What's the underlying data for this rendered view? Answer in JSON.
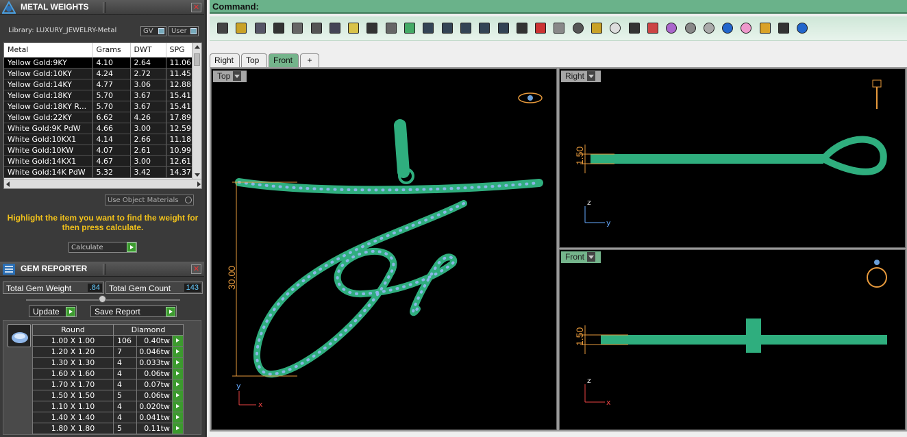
{
  "metal_weights": {
    "title": "METAL WEIGHTS",
    "library": "Library: LUXURY_JEWELRY-Metal",
    "toggle_gv": "GV",
    "toggle_user": "User",
    "columns": [
      "Metal",
      "Grams",
      "DWT",
      "SPG"
    ],
    "rows": [
      [
        "Yellow Gold:9KY",
        "4.10",
        "2.64",
        "11.06"
      ],
      [
        "Yellow Gold:10KY",
        "4.24",
        "2.72",
        "11.45"
      ],
      [
        "Yellow Gold:14KY",
        "4.77",
        "3.06",
        "12.88"
      ],
      [
        "Yellow Gold:18KY",
        "5.70",
        "3.67",
        "15.41"
      ],
      [
        "Yellow Gold:18KY R...",
        "5.70",
        "3.67",
        "15.41"
      ],
      [
        "Yellow Gold:22KY",
        "6.62",
        "4.26",
        "17.89"
      ],
      [
        "White Gold:9K PdW",
        "4.66",
        "3.00",
        "12.59"
      ],
      [
        "White Gold:10KX1",
        "4.14",
        "2.66",
        "11.18"
      ],
      [
        "White Gold:10KW",
        "4.07",
        "2.61",
        "10.99"
      ],
      [
        "White Gold:14KX1",
        "4.67",
        "3.00",
        "12.61"
      ],
      [
        "White Gold:14K PdW",
        "5.32",
        "3.42",
        "14.37"
      ]
    ],
    "use_object_materials": "Use Object Materials",
    "hint": "Highlight the item you want to find the weight for then press calculate.",
    "calculate": "Calculate"
  },
  "gem_reporter": {
    "title": "GEM REPORTER",
    "total_weight_label": "Total Gem Weight",
    "total_weight": ".84",
    "total_count_label": "Total Gem Count",
    "total_count": "143",
    "update": "Update",
    "save_report": "Save Report",
    "header_shape": "Round",
    "header_material": "Diamond",
    "rows": [
      [
        "1.00 X 1.00",
        "106",
        "0.40tw"
      ],
      [
        "1.20 X 1.20",
        "7",
        "0.046tw"
      ],
      [
        "1.30 X 1.30",
        "4",
        "0.033tw"
      ],
      [
        "1.60 X 1.60",
        "4",
        "0.06tw"
      ],
      [
        "1.70 X 1.70",
        "4",
        "0.07tw"
      ],
      [
        "1.50 X 1.50",
        "5",
        "0.06tw"
      ],
      [
        "1.10 X 1.10",
        "4",
        "0.020tw"
      ],
      [
        "1.40 X 1.40",
        "4",
        "0.041tw"
      ],
      [
        "1.80 X 1.80",
        "5",
        "0.11tw"
      ]
    ]
  },
  "command": {
    "label": "Command:"
  },
  "toolbar_icons": [
    "new-icon",
    "open-icon",
    "save-icon",
    "print-icon",
    "import-icon",
    "cut-icon",
    "copy-icon",
    "paste-icon",
    "undo-icon",
    "pan-icon",
    "move-icon",
    "zoom-icon",
    "zoom-window-icon",
    "zoom-extents-icon",
    "zoom-selected-icon",
    "rotate-view-icon",
    "viewport-layout-icon",
    "car-icon",
    "plane-icon",
    "gumball-icon",
    "osnap-icon",
    "light-icon",
    "lock-icon",
    "layers-icon",
    "color-wheel-icon",
    "sphere-shaded-icon",
    "sphere-render-icon",
    "sphere-blue-icon",
    "spotlight-icon",
    "settings-gear-icon",
    "dimension-icon",
    "help-icon"
  ],
  "view_tabs": [
    "Right",
    "Top",
    "Front"
  ],
  "viewports": {
    "top": {
      "label": "Top",
      "dimension": "30.00",
      "axis_y": "y",
      "axis_x": "x"
    },
    "right": {
      "label": "Right",
      "dimension": "1.50",
      "axis_z": "z",
      "axis_y": "y"
    },
    "front": {
      "label": "Front",
      "dimension": "1.50",
      "axis_z": "z",
      "axis_x": "x"
    }
  },
  "colors": {
    "accent_green": "#74b48b",
    "dim_orange": "#e89a3c",
    "hint_yellow": "#f2c21b",
    "metal_green": "#2fae7e",
    "gem_blue": "#8ab8e8"
  }
}
